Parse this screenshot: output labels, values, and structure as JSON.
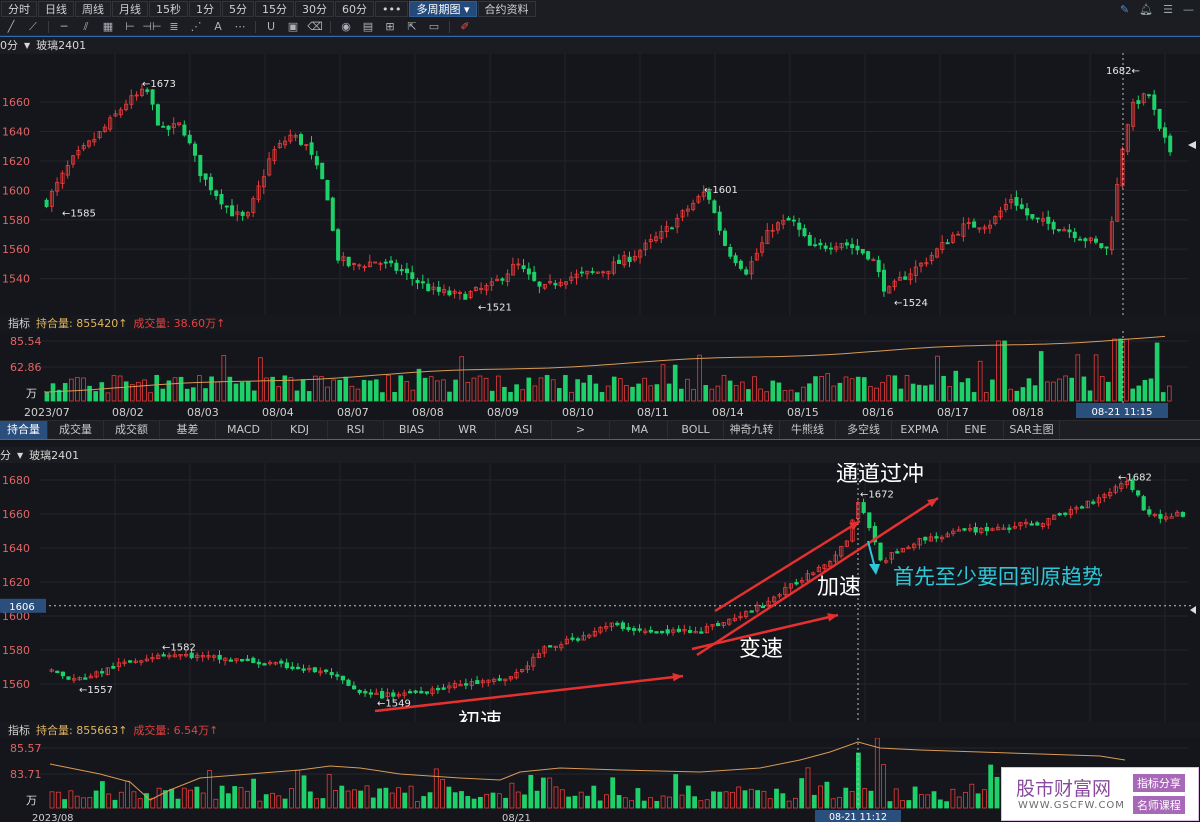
{
  "toolbar": {
    "buttons": [
      "分时",
      "日线",
      "周线",
      "月线",
      "15秒",
      "1分",
      "5分",
      "15分",
      "30分",
      "60分",
      "•••",
      "多周期图",
      "合约资料"
    ],
    "active": "多周期图"
  },
  "upper": {
    "title": {
      "period": "0分",
      "symbol": "玻璃2401"
    },
    "price_labels": [
      "1660",
      "1640",
      "1620",
      "1600",
      "1580",
      "1560",
      "1540"
    ],
    "annotations": {
      "high_left": "←1673",
      "low_left": "←1585",
      "low_mid": "←1521",
      "high_mid": "←1601",
      "low_right": "←1524",
      "high_right": "1682←"
    },
    "indicator": {
      "label": "指标",
      "oi": "持合量: 855420↑",
      "vol": "成交量: 38.60万↑",
      "v1": "85.54",
      "v2": "62.86",
      "unit": "万"
    },
    "date_labels": [
      "2023/07",
      "08/02",
      "08/03",
      "08/04",
      "08/07",
      "08/08",
      "08/09",
      "08/10",
      "08/11",
      "08/14",
      "08/15",
      "08/16",
      "08/17",
      "08/18"
    ],
    "cursor_time": "08-21 11:15"
  },
  "tabs": {
    "left": [
      "持合量",
      "成交量",
      "成交额",
      "基差",
      "MACD",
      "KDJ",
      "RSI",
      "BIAS",
      "WR",
      "ASI"
    ],
    "arrow": ">",
    "right": [
      "MA",
      "BOLL",
      "神奇九转",
      "牛熊线",
      "多空线",
      "EXPMA",
      "ENE",
      "SAR主图"
    ],
    "active": "持合量"
  },
  "lower": {
    "title": {
      "period": "分",
      "symbol": "玻璃2401"
    },
    "price_labels": [
      "1680",
      "1660",
      "1640",
      "1620",
      "1600",
      "1580",
      "1560"
    ],
    "crosshair_price": "1606",
    "annotations": {
      "p1582": "←1582",
      "p1557": "←1557",
      "p1549": "←1549",
      "p1672": "←1672",
      "p1682": "←1682"
    },
    "overlays": {
      "t1": "通道过冲",
      "t2": "加速",
      "t3": "首先至少要回到原趋势",
      "t4": "变速",
      "t5": "初速"
    },
    "indicator": {
      "label": "指标",
      "oi": "持合量: 855663↑",
      "vol": "成交量: 6.54万↑",
      "v1": "85.57",
      "v2": "83.71",
      "unit": "万"
    },
    "date_labels": [
      "2023/08",
      "08/21"
    ],
    "cursor_time": "08-21 11:12"
  },
  "watermark": {
    "brand": "股市财富网",
    "url": "WWW.GSCFW.COM",
    "tag1": "指标分享",
    "tag2": "名师课程"
  },
  "colors": {
    "up": "#e83b3b",
    "down": "#1fd06a",
    "ma": "#d99a55",
    "accent": "#2f6bb0",
    "annotation": "#2ec7d8"
  }
}
